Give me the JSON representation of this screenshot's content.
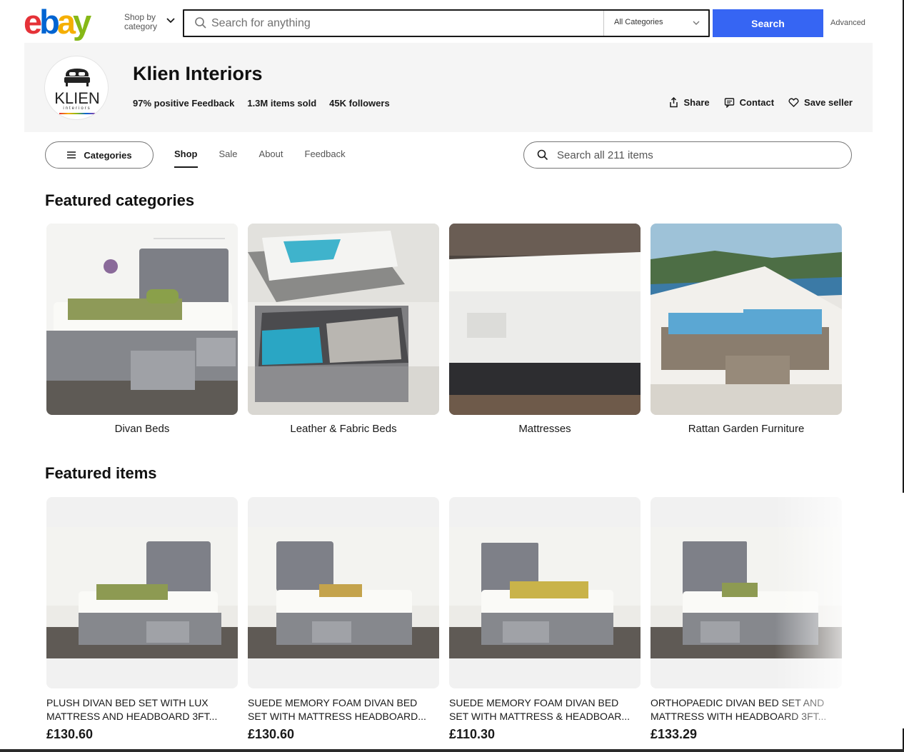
{
  "header": {
    "logo_letters": [
      "e",
      "b",
      "a",
      "y"
    ],
    "shop_by_category": "Shop by category",
    "search_placeholder": "Search for anything",
    "category_select": "All Categories",
    "search_button": "Search",
    "advanced_link": "Advanced"
  },
  "store": {
    "name": "Klien Interiors",
    "logo_text": "KLIEN",
    "logo_subtext": "interiors",
    "positive_feedback": "97% positive Feedback",
    "items_sold": "1.3M items sold",
    "followers": "45K followers",
    "actions": {
      "share": "Share",
      "contact": "Contact",
      "save_seller": "Save seller"
    }
  },
  "store_nav": {
    "categories_button": "Categories",
    "tabs": [
      {
        "label": "Shop",
        "active": true
      },
      {
        "label": "Sale",
        "active": false
      },
      {
        "label": "About",
        "active": false
      },
      {
        "label": "Feedback",
        "active": false
      }
    ],
    "search_placeholder": "Search all 211 items"
  },
  "featured_categories": {
    "title": "Featured categories",
    "items": [
      {
        "label": "Divan Beds"
      },
      {
        "label": "Leather & Fabric Beds"
      },
      {
        "label": "Mattresses"
      },
      {
        "label": "Rattan Garden Furniture"
      }
    ]
  },
  "featured_items": {
    "title": "Featured items",
    "items": [
      {
        "title": "PLUSH DIVAN BED SET WITH LUX MATTRESS AND HEADBOARD 3FT...",
        "price": "£130.60"
      },
      {
        "title": "SUEDE MEMORY FOAM DIVAN BED SET WITH MATTRESS HEADBOARD...",
        "price": "£130.60"
      },
      {
        "title": "SUEDE MEMORY FOAM DIVAN BED SET WITH MATTRESS & HEADBOAR...",
        "price": "£110.30"
      },
      {
        "title": "ORTHOPAEDIC DIVAN BED SET AND MATTRESS WITH HEADBOARD 3FT...",
        "price": "£133.29"
      }
    ]
  },
  "colors": {
    "search_button": "#3665f3",
    "banner_bg": "#f5f5f5",
    "ebay_red": "#e53238",
    "ebay_blue": "#0064d2",
    "ebay_yellow": "#f5af02",
    "ebay_green": "#86b817"
  }
}
